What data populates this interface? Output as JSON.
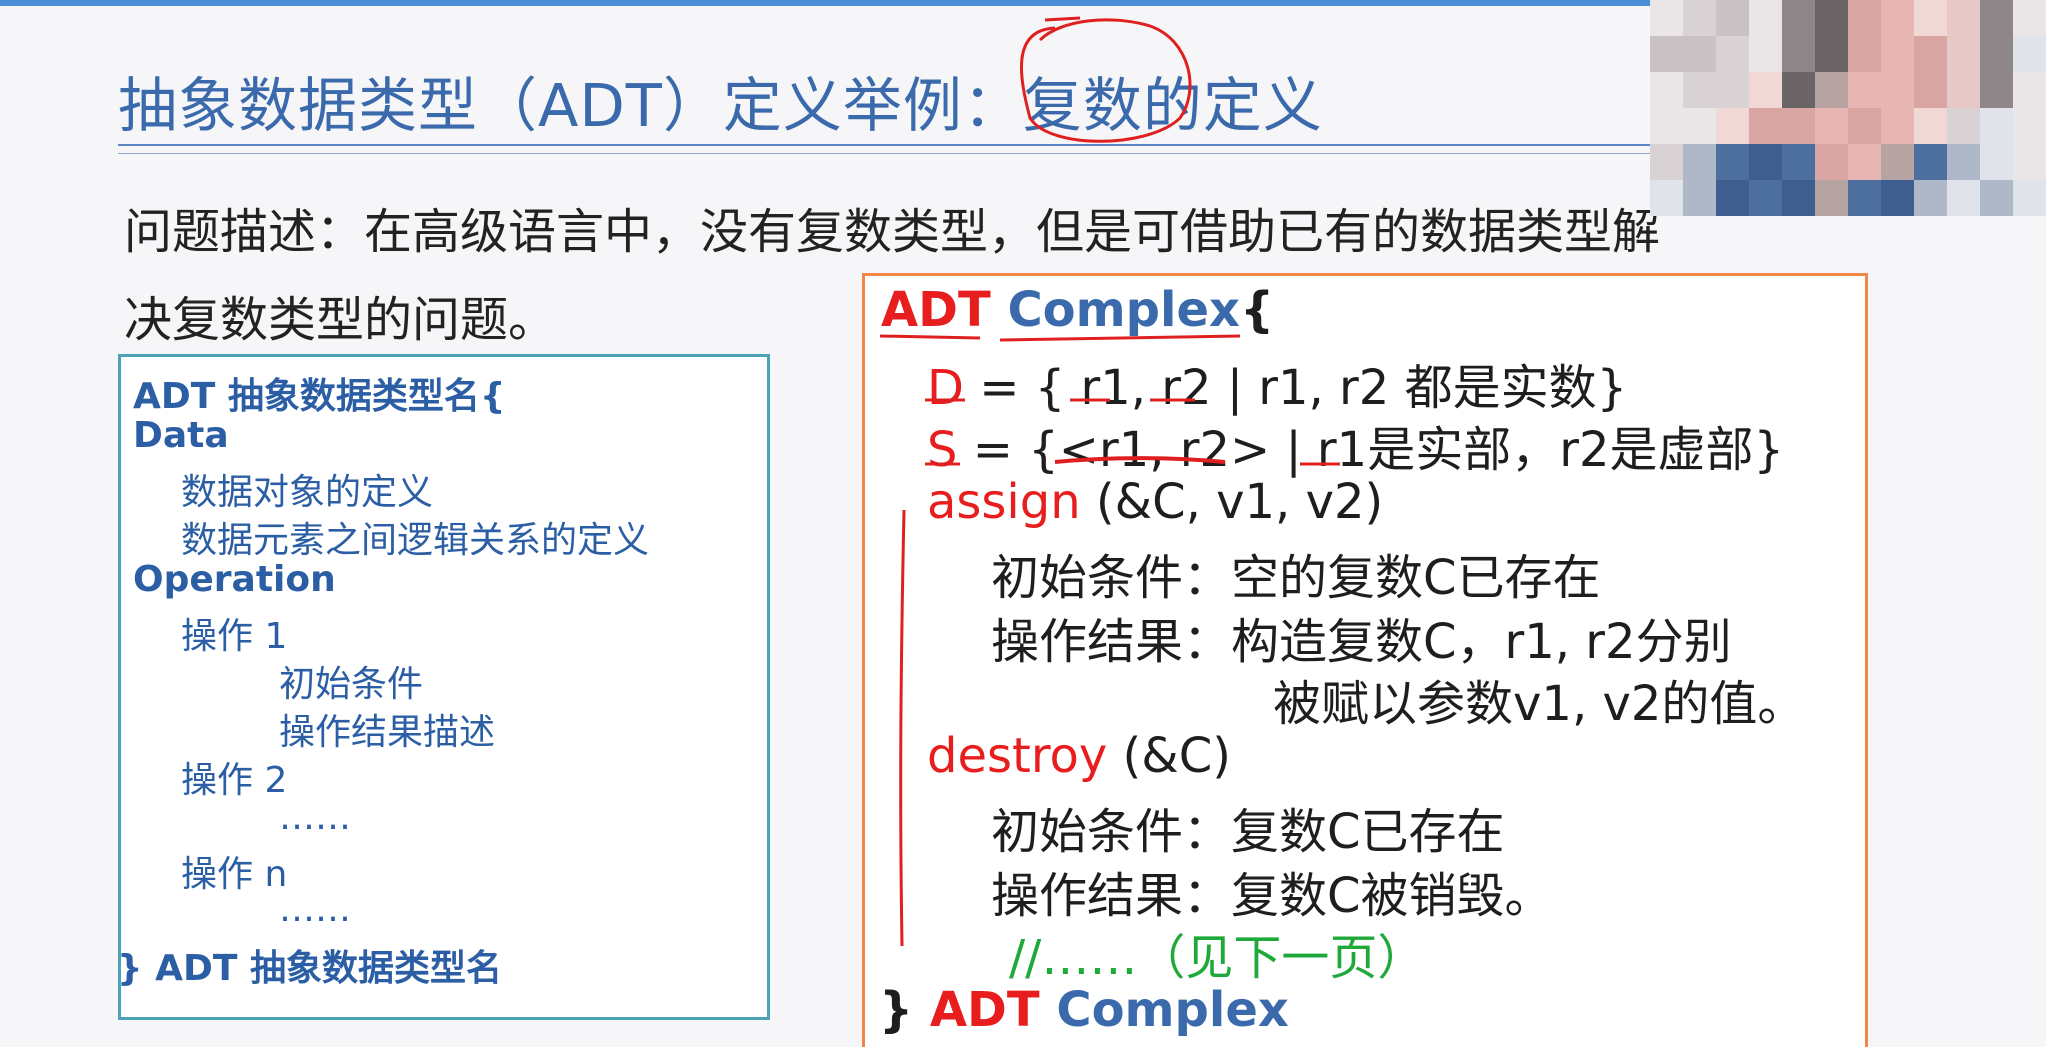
{
  "slide": {
    "title": "抽象数据类型（ADT）定义举例：复数的定义",
    "problem_line1": "问题描述：在高级语言中，没有复数类型，但是可借助已有的数据类型解",
    "problem_line2": "决复数类型的问题。"
  },
  "template_box": {
    "line1": "ADT 抽象数据类型名{",
    "line2": "Data",
    "line3": "数据对象的定义",
    "line4": "数据元素之间逻辑关系的定义",
    "line5": "Operation",
    "line6": "操作 1",
    "line7": "初始条件",
    "line8": "操作结果描述",
    "line9": "操作 2",
    "line10": "……",
    "line11": "操作 n",
    "line12": "……",
    "line13": "} ADT  抽象数据类型名"
  },
  "complex_box": {
    "head_adt": "ADT",
    "head_name": "Complex",
    "head_brace": "{",
    "d_key": "D",
    "d_rest": " = { r1, r2 | r1, r2 都是实数}",
    "s_key": "S",
    "s_rest": " = {<r1, r2> | r1是实部，r2是虚部}",
    "assign_name": "assign",
    "assign_params": " (&C, v1, v2)",
    "assign_pre": "初始条件：空的复数C已存在",
    "assign_post1": "操作结果：构造复数C，r1, r2分别",
    "assign_post2": "被赋以参数v1, v2的值。",
    "destroy_name": "destroy",
    "destroy_params": " (&C)",
    "destroy_pre": "初始条件：复数C已存在",
    "destroy_post": "操作结果：复数C被销毁。",
    "comment": "//……（见下一页）",
    "end_brace": "} ",
    "end_adt": "ADT",
    "end_name": " Complex"
  },
  "colors": {
    "title": "#3a6aab",
    "keyword_red": "#e81e1e",
    "template_text": "#2b5ea4",
    "template_border": "#4aa3b8",
    "complex_border": "#f0884a",
    "comment_green": "#1fa93a",
    "annotation_ink": "#e02020"
  },
  "webcam": {
    "icon": "presenter-video-thumbnail"
  }
}
